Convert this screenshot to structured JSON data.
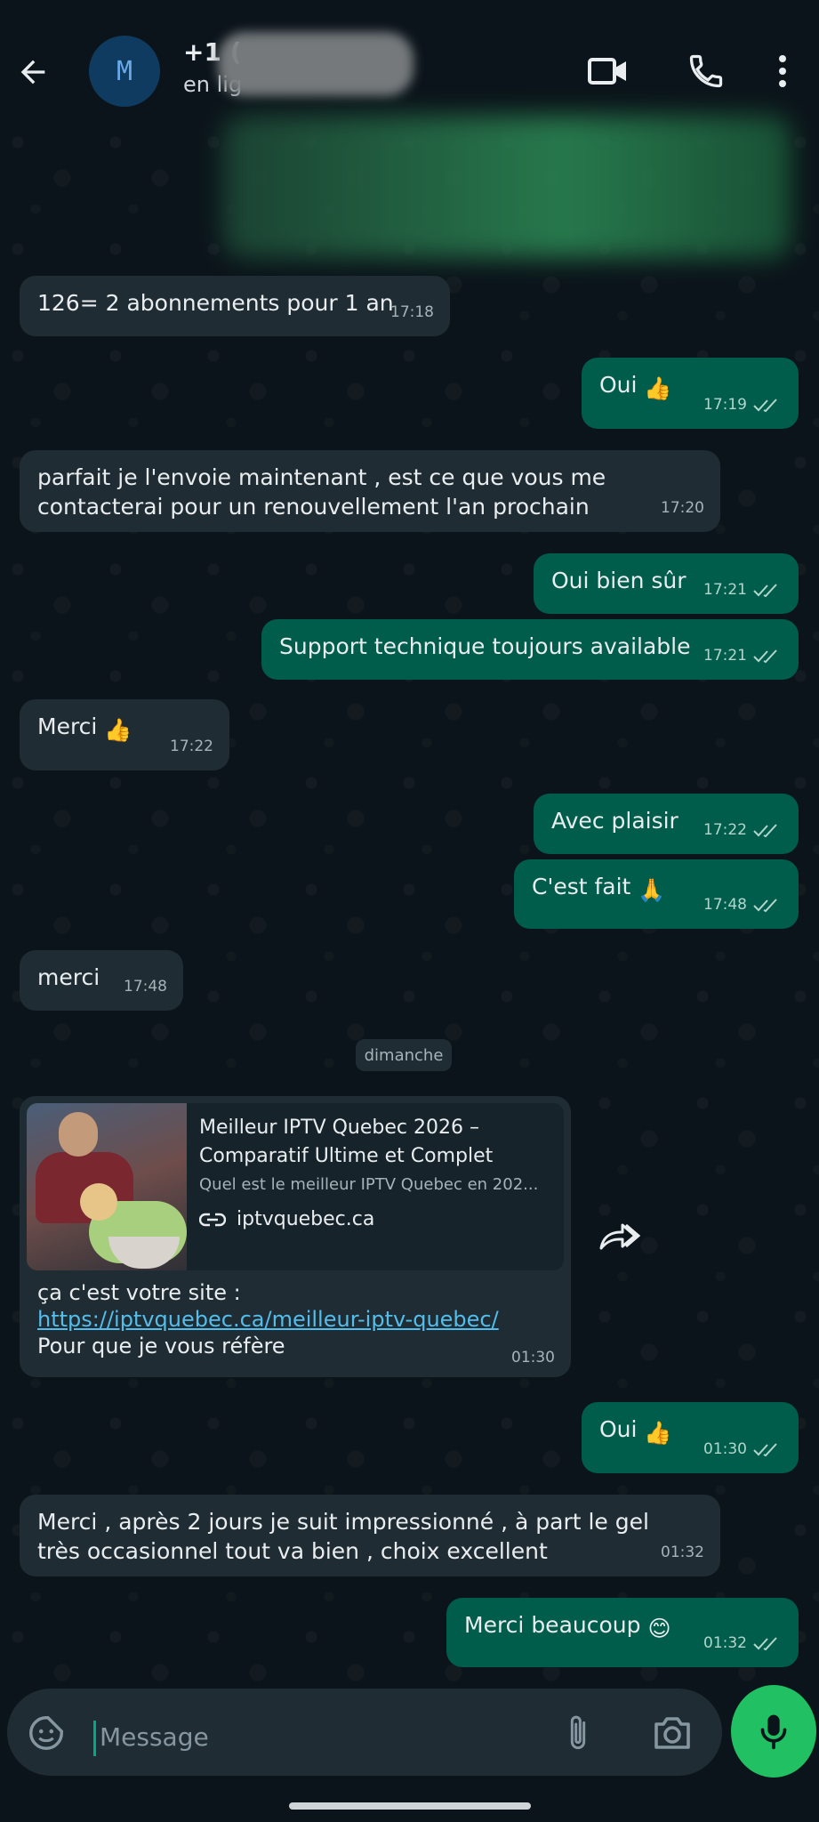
{
  "header": {
    "avatar_letter": "M",
    "contact_name": "+1 (",
    "status": "en lig",
    "icons": [
      "back-arrow-icon",
      "video-call-icon",
      "phone-icon",
      "more-vert-icon"
    ]
  },
  "messages": [
    {
      "dir": "in",
      "text": "126= 2 abonnements pour 1 an",
      "time": "17:18"
    },
    {
      "dir": "out",
      "text": "Oui",
      "emoji": "👍",
      "time": "17:19"
    },
    {
      "dir": "in",
      "text": "parfait je l'envoie maintenant , est ce que vous me contacterai pour un renouvellement l'an prochain",
      "time": "17:20"
    },
    {
      "dir": "out",
      "text": "Oui bien sûr",
      "time": "17:21"
    },
    {
      "dir": "out",
      "text": "Support technique toujours available",
      "time": "17:21"
    },
    {
      "dir": "in",
      "text": "Merci",
      "emoji": "👍",
      "time": "17:22"
    },
    {
      "dir": "out",
      "text": "Avec plaisir",
      "time": "17:22"
    },
    {
      "dir": "out",
      "text": "C'est fait",
      "emoji": "🙏",
      "time": "17:48"
    },
    {
      "dir": "in",
      "text": "merci",
      "time": "17:48"
    },
    {
      "dir": "out",
      "text": "Oui",
      "emoji": "👍",
      "time": "01:30"
    },
    {
      "dir": "in",
      "text": "Merci , après 2 jours je suit impressionné , à part le gel très occasionnel tout va bien , choix excellent",
      "time": "01:32"
    },
    {
      "dir": "out",
      "text": "Merci beaucoup",
      "emoji": "😊",
      "time": "01:32"
    }
  ],
  "day_separator": "dimanche",
  "link_message": {
    "preview_title": "Meilleur IPTV Quebec 2026 – Comparatif Ultime et Complet",
    "preview_desc": "Quel est le meilleur IPTV Quebec en 202...",
    "preview_domain": "iptvquebec.ca",
    "body_line1": "ça c'est votre site :",
    "url": "https://iptvquebec.ca/meilleur-iptv-quebec/",
    "body_line3": "Pour que je vous réfère",
    "time": "01:30"
  },
  "composer": {
    "placeholder": "Message",
    "icons": [
      "sticker-icon",
      "attach-icon",
      "camera-icon",
      "mic-icon"
    ]
  }
}
